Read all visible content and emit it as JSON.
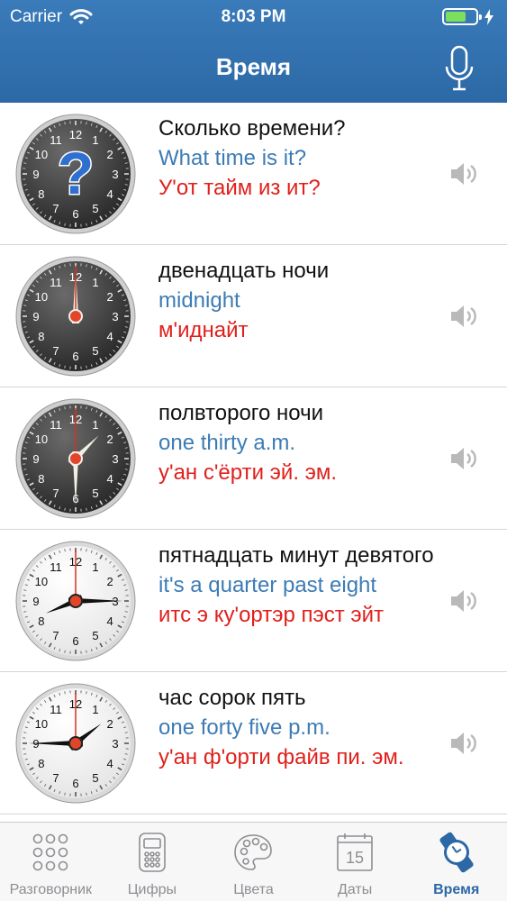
{
  "status_bar": {
    "carrier": "Carrier",
    "time": "8:03 PM"
  },
  "header": {
    "title": "Время"
  },
  "clock_numbers": [
    "12",
    "1",
    "2",
    "3",
    "4",
    "5",
    "6",
    "7",
    "8",
    "9",
    "10",
    "11"
  ],
  "rows": [
    {
      "ru": "Сколько времени?",
      "en": "What time is it?",
      "tr": "У'от тайм из ит?"
    },
    {
      "ru": "двенадцать ночи",
      "en": "midnight",
      "tr": "м'иднайт"
    },
    {
      "ru": "полвторого ночи",
      "en": "one thirty a.m.",
      "tr": "у'ан с'ёрти эй. эм."
    },
    {
      "ru": "пятнадцать минут девятого",
      "en": "it's a quarter past eight",
      "tr": "итс э ку'ортэр пэст эйт"
    },
    {
      "ru": "час сорок пять",
      "en": "one forty five p.m.",
      "tr": "у'ан ф'орти файв пи. эм."
    }
  ],
  "tabs": [
    {
      "label": "Разговорник",
      "icon": "dots-grid-icon"
    },
    {
      "label": "Цифры",
      "icon": "calculator-icon"
    },
    {
      "label": "Цвета",
      "icon": "palette-icon"
    },
    {
      "label": "Даты",
      "icon": "calendar-icon",
      "day": "15"
    },
    {
      "label": "Время",
      "icon": "watch-icon",
      "active": true
    }
  ],
  "colors": {
    "header": "#2e6dab",
    "english": "#3c7bb4",
    "transcription": "#e0201b",
    "tab_active": "#2c68a6"
  }
}
